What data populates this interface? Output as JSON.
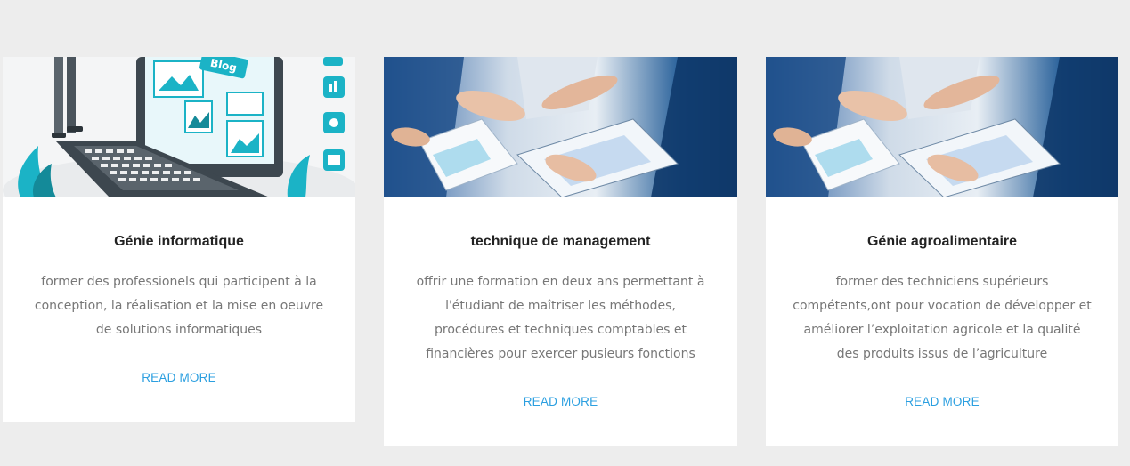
{
  "colors": {
    "accent": "#2b9fe0",
    "link": "#2b9fe0",
    "page_background": "#ededed",
    "card_background": "#ffffff"
  },
  "cards": [
    {
      "title": "Génie informatique",
      "description": "former des professionels qui participent à la conception, la réalisation et la mise en oeuvre de solutions informatiques",
      "link_label": "READ MORE",
      "image": {
        "subject": "blog-laptop-illustration",
        "label": "Blog"
      }
    },
    {
      "title": "technique de management",
      "description": "offrir une formation en deux ans permettant à l'étudiant de maîtriser les méthodes, procédures et techniques comptables et financières pour exercer pusieurs fonctions",
      "link_label": "READ MORE",
      "image": {
        "subject": "business-meeting-charts-photo"
      }
    },
    {
      "title": "Génie agroalimentaire",
      "description": "former des techniciens supérieurs compétents,ont pour vocation de développer et améliorer l’exploitation agricole et la qualité des produits issus de l’agriculture",
      "link_label": "READ MORE",
      "image": {
        "subject": "business-meeting-charts-photo"
      }
    }
  ]
}
